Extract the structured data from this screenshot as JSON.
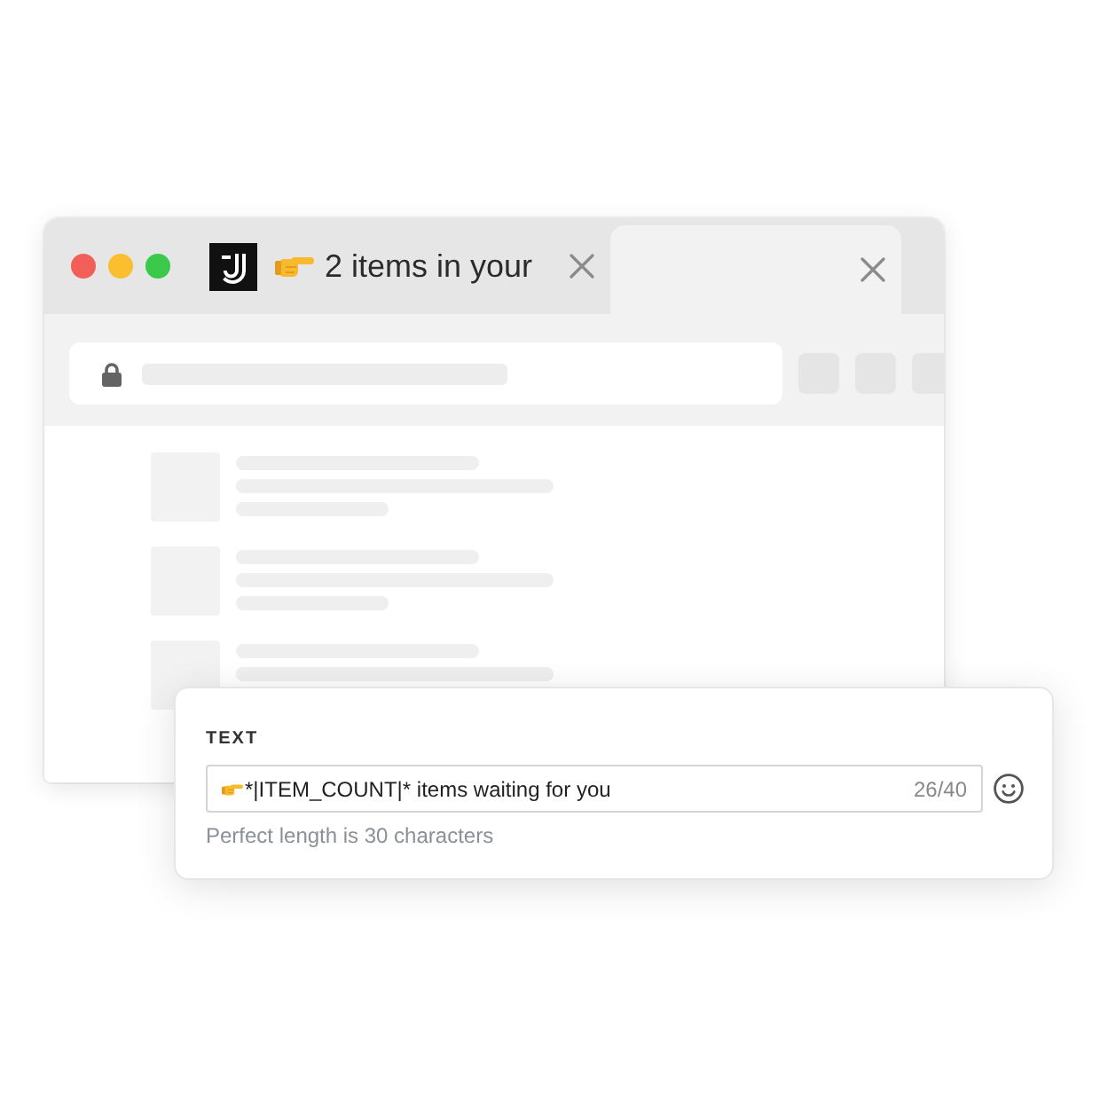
{
  "browser": {
    "window_controls": [
      {
        "color": "#f25f58"
      },
      {
        "color": "#fbbe2f"
      },
      {
        "color": "#3ac94a"
      }
    ],
    "tabs": [
      {
        "title": "2 items in your",
        "selected": false
      },
      {
        "selected": true
      }
    ]
  },
  "text_card": {
    "label": "TEXT",
    "field": {
      "value": "*|ITEM_COUNT|* items waiting for you",
      "counter": "26/40"
    },
    "helper": "Perfect length is 30 characters"
  }
}
